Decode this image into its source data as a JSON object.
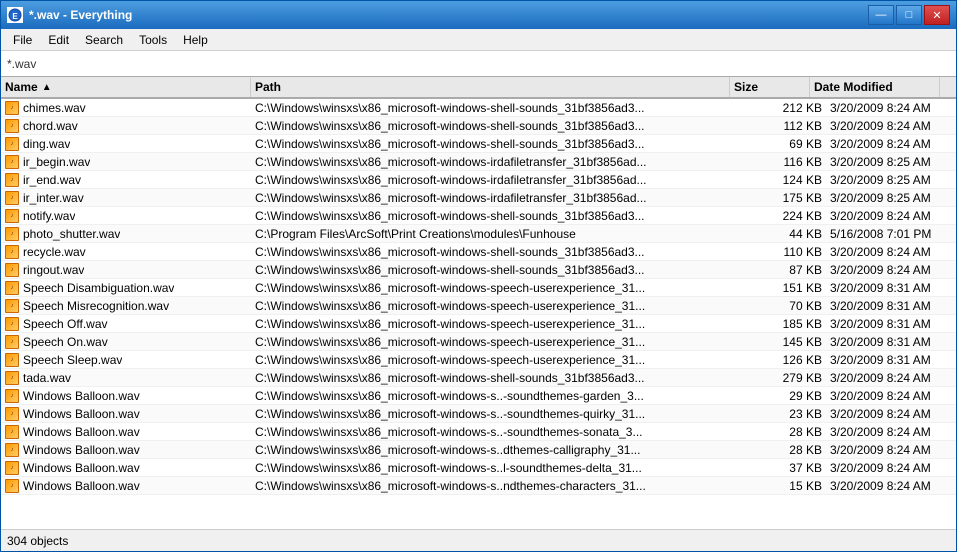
{
  "window": {
    "title": "*.wav - Everything",
    "search_query": "*.wav"
  },
  "menu": {
    "items": [
      "File",
      "Edit",
      "Search",
      "Tools",
      "Help"
    ]
  },
  "search": {
    "label": "Search",
    "placeholder": "*.wav",
    "value": "*.wav"
  },
  "columns": {
    "name": "Name",
    "path": "Path",
    "size": "Size",
    "date_modified": "Date Modified"
  },
  "files": [
    {
      "name": "chimes.wav",
      "path": "C:\\Windows\\winsxs\\x86_microsoft-windows-shell-sounds_31bf3856ad3...",
      "size": "212 KB",
      "date": "3/20/2009 8:24 AM"
    },
    {
      "name": "chord.wav",
      "path": "C:\\Windows\\winsxs\\x86_microsoft-windows-shell-sounds_31bf3856ad3...",
      "size": "112 KB",
      "date": "3/20/2009 8:24 AM"
    },
    {
      "name": "ding.wav",
      "path": "C:\\Windows\\winsxs\\x86_microsoft-windows-shell-sounds_31bf3856ad3...",
      "size": "69 KB",
      "date": "3/20/2009 8:24 AM"
    },
    {
      "name": "ir_begin.wav",
      "path": "C:\\Windows\\winsxs\\x86_microsoft-windows-irdafiletransfer_31bf3856ad...",
      "size": "116 KB",
      "date": "3/20/2009 8:25 AM"
    },
    {
      "name": "ir_end.wav",
      "path": "C:\\Windows\\winsxs\\x86_microsoft-windows-irdafiletransfer_31bf3856ad...",
      "size": "124 KB",
      "date": "3/20/2009 8:25 AM"
    },
    {
      "name": "ir_inter.wav",
      "path": "C:\\Windows\\winsxs\\x86_microsoft-windows-irdafiletransfer_31bf3856ad...",
      "size": "175 KB",
      "date": "3/20/2009 8:25 AM"
    },
    {
      "name": "notify.wav",
      "path": "C:\\Windows\\winsxs\\x86_microsoft-windows-shell-sounds_31bf3856ad3...",
      "size": "224 KB",
      "date": "3/20/2009 8:24 AM"
    },
    {
      "name": "photo_shutter.wav",
      "path": "C:\\Program Files\\ArcSoft\\Print Creations\\modules\\Funhouse",
      "size": "44 KB",
      "date": "5/16/2008 7:01 PM"
    },
    {
      "name": "recycle.wav",
      "path": "C:\\Windows\\winsxs\\x86_microsoft-windows-shell-sounds_31bf3856ad3...",
      "size": "110 KB",
      "date": "3/20/2009 8:24 AM"
    },
    {
      "name": "ringout.wav",
      "path": "C:\\Windows\\winsxs\\x86_microsoft-windows-shell-sounds_31bf3856ad3...",
      "size": "87 KB",
      "date": "3/20/2009 8:24 AM"
    },
    {
      "name": "Speech Disambiguation.wav",
      "path": "C:\\Windows\\winsxs\\x86_microsoft-windows-speech-userexperience_31...",
      "size": "151 KB",
      "date": "3/20/2009 8:31 AM"
    },
    {
      "name": "Speech Misrecognition.wav",
      "path": "C:\\Windows\\winsxs\\x86_microsoft-windows-speech-userexperience_31...",
      "size": "70 KB",
      "date": "3/20/2009 8:31 AM"
    },
    {
      "name": "Speech Off.wav",
      "path": "C:\\Windows\\winsxs\\x86_microsoft-windows-speech-userexperience_31...",
      "size": "185 KB",
      "date": "3/20/2009 8:31 AM"
    },
    {
      "name": "Speech On.wav",
      "path": "C:\\Windows\\winsxs\\x86_microsoft-windows-speech-userexperience_31...",
      "size": "145 KB",
      "date": "3/20/2009 8:31 AM"
    },
    {
      "name": "Speech Sleep.wav",
      "path": "C:\\Windows\\winsxs\\x86_microsoft-windows-speech-userexperience_31...",
      "size": "126 KB",
      "date": "3/20/2009 8:31 AM"
    },
    {
      "name": "tada.wav",
      "path": "C:\\Windows\\winsxs\\x86_microsoft-windows-shell-sounds_31bf3856ad3...",
      "size": "279 KB",
      "date": "3/20/2009 8:24 AM"
    },
    {
      "name": "Windows Balloon.wav",
      "path": "C:\\Windows\\winsxs\\x86_microsoft-windows-s..-soundthemes-garden_3...",
      "size": "29 KB",
      "date": "3/20/2009 8:24 AM"
    },
    {
      "name": "Windows Balloon.wav",
      "path": "C:\\Windows\\winsxs\\x86_microsoft-windows-s..-soundthemes-quirky_31...",
      "size": "23 KB",
      "date": "3/20/2009 8:24 AM"
    },
    {
      "name": "Windows Balloon.wav",
      "path": "C:\\Windows\\winsxs\\x86_microsoft-windows-s..-soundthemes-sonata_3...",
      "size": "28 KB",
      "date": "3/20/2009 8:24 AM"
    },
    {
      "name": "Windows Balloon.wav",
      "path": "C:\\Windows\\winsxs\\x86_microsoft-windows-s..dthemes-calligraphy_31...",
      "size": "28 KB",
      "date": "3/20/2009 8:24 AM"
    },
    {
      "name": "Windows Balloon.wav",
      "path": "C:\\Windows\\winsxs\\x86_microsoft-windows-s..l-soundthemes-delta_31...",
      "size": "37 KB",
      "date": "3/20/2009 8:24 AM"
    },
    {
      "name": "Windows Balloon.wav",
      "path": "C:\\Windows\\winsxs\\x86_microsoft-windows-s..ndthemes-characters_31...",
      "size": "15 KB",
      "date": "3/20/2009 8:24 AM"
    }
  ],
  "status": {
    "count_label": "304 objects"
  },
  "title_buttons": {
    "minimize": "—",
    "maximize": "□",
    "close": "✕"
  }
}
